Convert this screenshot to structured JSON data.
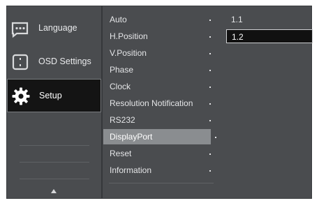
{
  "menu": {
    "left_items": [
      {
        "label": "Language",
        "icon": "language-icon",
        "selected": false
      },
      {
        "label": "OSD Settings",
        "icon": "osd-settings-icon",
        "selected": false
      },
      {
        "label": "Setup",
        "icon": "gear-icon",
        "selected": true
      }
    ],
    "setup_items": [
      "Auto",
      "H.Position",
      "V.Position",
      "Phase",
      "Clock",
      "Resolution Notification",
      "RS232",
      "DisplayPort",
      "Reset",
      "Information"
    ],
    "selected_item": "DisplayPort",
    "options": [
      "1.1",
      "1.2"
    ],
    "selected_option": "1.2",
    "scroll_icon": "up-arrow-icon"
  },
  "colors": {
    "panel": "#4a4c4f",
    "selected_bg": "#141414",
    "highlight": "#8a8d90"
  }
}
